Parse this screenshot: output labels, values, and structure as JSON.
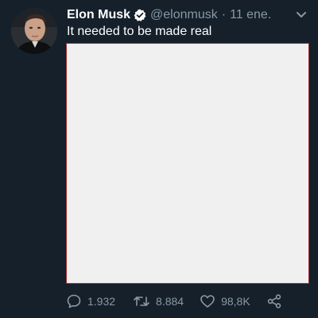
{
  "tweet": {
    "author_name": "Elon Musk",
    "handle": "@elonmusk",
    "separator": "·",
    "date": "11 ene.",
    "text": "It needed to be made real",
    "media_colors": {
      "fill": "#f0f0f0",
      "border": "#a12a2a"
    },
    "stats": {
      "replies": "1.932",
      "retweets": "8.884",
      "likes": "98,8K"
    }
  },
  "icons": {
    "verified": "verified-badge-icon",
    "caret": "chevron-down-icon",
    "reply": "reply-icon",
    "retweet": "retweet-icon",
    "like": "heart-icon",
    "share": "share-icon"
  },
  "colors": {
    "background": "#15202b",
    "primary_text": "#ffffff",
    "secondary_text": "#8899a6",
    "verified_badge": "#ffffff"
  }
}
